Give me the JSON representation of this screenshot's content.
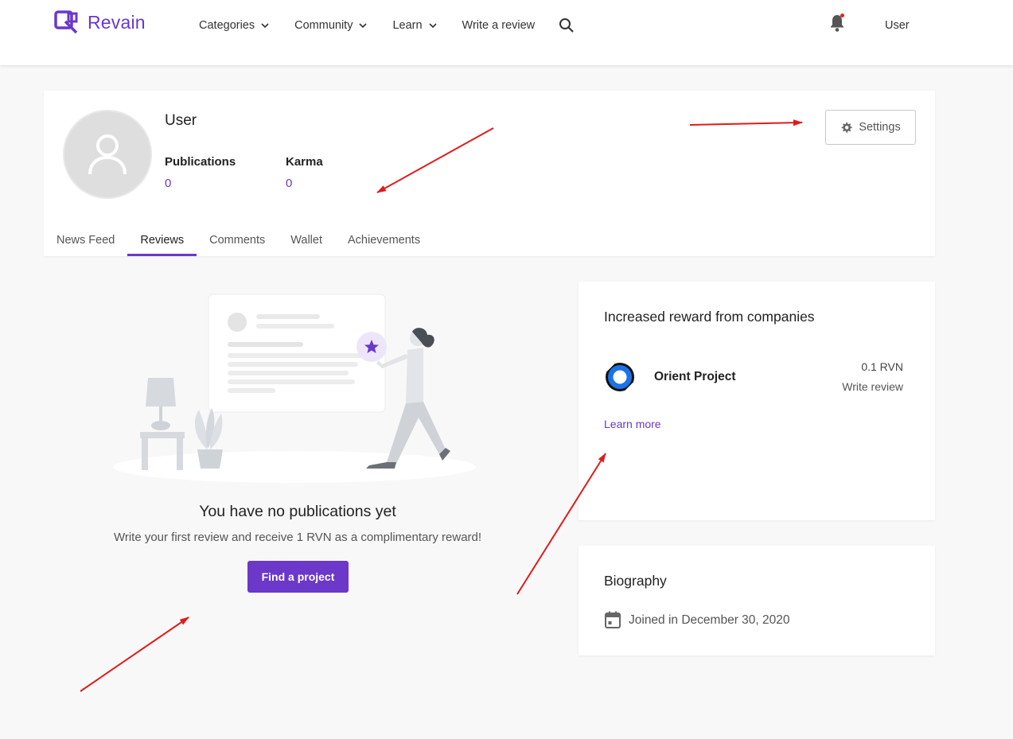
{
  "header": {
    "brand": "Revain",
    "nav": [
      "Categories",
      "Community",
      "Learn",
      "Write a review"
    ],
    "user_label": "User"
  },
  "profile": {
    "name": "User",
    "publications_label": "Publications",
    "publications_value": "0",
    "karma_label": "Karma",
    "karma_value": "0",
    "settings_label": "Settings",
    "tabs": [
      "News Feed",
      "Reviews",
      "Comments",
      "Wallet",
      "Achievements"
    ],
    "active_tab": "Reviews"
  },
  "empty_state": {
    "title": "You have no publications yet",
    "text": "Write your first review and receive 1 RVN as a complimentary reward!",
    "button": "Find a project"
  },
  "rewards": {
    "title": "Increased reward from companies",
    "company_name": "Orient Project",
    "amount": "0.1 RVN",
    "action": "Write review",
    "learn_more": "Learn more"
  },
  "biography": {
    "title": "Biography",
    "joined": "Joined in December 30, 2020"
  },
  "colors": {
    "brand": "#6b38c9",
    "annotation": "#e01b1b"
  }
}
